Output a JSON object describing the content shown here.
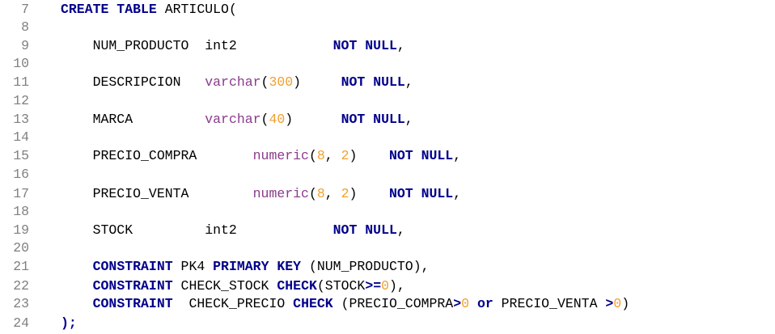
{
  "editor": {
    "lines": [
      {
        "num": "7",
        "tokens": [
          {
            "t": "CREATE TABLE",
            "c": "kw"
          },
          {
            "t": " ARTICULO(",
            "c": "tx"
          }
        ]
      },
      {
        "num": "8",
        "tokens": []
      },
      {
        "num": "9",
        "tokens": [
          {
            "t": "    NUM_PRODUCTO  int2            ",
            "c": "tx"
          },
          {
            "t": "NOT NULL",
            "c": "kw"
          },
          {
            "t": ",",
            "c": "tx"
          }
        ]
      },
      {
        "num": "10",
        "tokens": []
      },
      {
        "num": "11",
        "tokens": [
          {
            "t": "    DESCRIPCION   ",
            "c": "tx"
          },
          {
            "t": "varchar",
            "c": "ty"
          },
          {
            "t": "(",
            "c": "tx"
          },
          {
            "t": "300",
            "c": "num"
          },
          {
            "t": ")     ",
            "c": "tx"
          },
          {
            "t": "NOT NULL",
            "c": "kw"
          },
          {
            "t": ",",
            "c": "tx"
          }
        ]
      },
      {
        "num": "12",
        "tokens": []
      },
      {
        "num": "13",
        "tokens": [
          {
            "t": "    MARCA         ",
            "c": "tx"
          },
          {
            "t": "varchar",
            "c": "ty"
          },
          {
            "t": "(",
            "c": "tx"
          },
          {
            "t": "40",
            "c": "num"
          },
          {
            "t": ")      ",
            "c": "tx"
          },
          {
            "t": "NOT NULL",
            "c": "kw"
          },
          {
            "t": ",",
            "c": "tx"
          }
        ]
      },
      {
        "num": "14",
        "tokens": []
      },
      {
        "num": "15",
        "tokens": [
          {
            "t": "    PRECIO_COMPRA       ",
            "c": "tx"
          },
          {
            "t": "numeric",
            "c": "ty"
          },
          {
            "t": "(",
            "c": "tx"
          },
          {
            "t": "8",
            "c": "num"
          },
          {
            "t": ", ",
            "c": "tx"
          },
          {
            "t": "2",
            "c": "num"
          },
          {
            "t": ")    ",
            "c": "tx"
          },
          {
            "t": "NOT NULL",
            "c": "kw"
          },
          {
            "t": ",",
            "c": "tx"
          }
        ]
      },
      {
        "num": "16",
        "tokens": []
      },
      {
        "num": "17",
        "tokens": [
          {
            "t": "    PRECIO_VENTA        ",
            "c": "tx"
          },
          {
            "t": "numeric",
            "c": "ty"
          },
          {
            "t": "(",
            "c": "tx"
          },
          {
            "t": "8",
            "c": "num"
          },
          {
            "t": ", ",
            "c": "tx"
          },
          {
            "t": "2",
            "c": "num"
          },
          {
            "t": ")    ",
            "c": "tx"
          },
          {
            "t": "NOT NULL",
            "c": "kw"
          },
          {
            "t": ",",
            "c": "tx"
          }
        ]
      },
      {
        "num": "18",
        "tokens": []
      },
      {
        "num": "19",
        "tokens": [
          {
            "t": "    STOCK         int2            ",
            "c": "tx"
          },
          {
            "t": "NOT NULL",
            "c": "kw"
          },
          {
            "t": ",",
            "c": "tx"
          }
        ]
      },
      {
        "num": "20",
        "tokens": []
      },
      {
        "num": "21",
        "tokens": [
          {
            "t": "    ",
            "c": "tx"
          },
          {
            "t": "CONSTRAINT",
            "c": "kw"
          },
          {
            "t": " PK4 ",
            "c": "tx"
          },
          {
            "t": "PRIMARY KEY",
            "c": "kw"
          },
          {
            "t": " (NUM_PRODUCTO),",
            "c": "tx"
          }
        ]
      },
      {
        "num": "22",
        "tokens": [
          {
            "t": "    ",
            "c": "tx"
          },
          {
            "t": "CONSTRAINT",
            "c": "kw"
          },
          {
            "t": " CHECK_STOCK ",
            "c": "tx"
          },
          {
            "t": "CHECK",
            "c": "kw"
          },
          {
            "t": "(STOCK",
            "c": "tx"
          },
          {
            "t": ">=",
            "c": "kw"
          },
          {
            "t": "0",
            "c": "num"
          },
          {
            "t": "),",
            "c": "tx"
          }
        ]
      },
      {
        "num": "23",
        "tokens": [
          {
            "t": "    ",
            "c": "tx"
          },
          {
            "t": "CONSTRAINT",
            "c": "kw"
          },
          {
            "t": "  CHECK_PRECIO ",
            "c": "tx"
          },
          {
            "t": "CHECK",
            "c": "kw"
          },
          {
            "t": " (PRECIO_COMPRA",
            "c": "tx"
          },
          {
            "t": ">",
            "c": "kw"
          },
          {
            "t": "0",
            "c": "num"
          },
          {
            "t": " ",
            "c": "tx"
          },
          {
            "t": "or",
            "c": "kw"
          },
          {
            "t": " PRECIO_VENTA ",
            "c": "tx"
          },
          {
            "t": ">",
            "c": "kw"
          },
          {
            "t": "0",
            "c": "num"
          },
          {
            "t": ")",
            "c": "tx"
          }
        ]
      },
      {
        "num": "24",
        "tokens": [
          {
            "t": ");",
            "c": "kw"
          }
        ]
      }
    ],
    "colors": {
      "keyword": "#00008b",
      "type": "#8b3a8b",
      "number": "#f0a030",
      "line_number": "#808080",
      "text": "#000000",
      "background": "#ffffff"
    }
  }
}
